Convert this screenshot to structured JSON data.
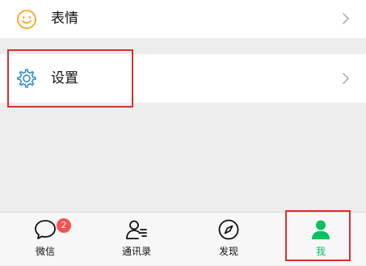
{
  "menu": {
    "emoji_label": "表情",
    "settings_label": "设置"
  },
  "tabbar": {
    "tabs": [
      {
        "label": "微信",
        "icon": "chat-bubble-icon",
        "badge": "2"
      },
      {
        "label": "通讯录",
        "icon": "contacts-icon"
      },
      {
        "label": "发现",
        "icon": "compass-icon"
      },
      {
        "label": "我",
        "icon": "person-icon",
        "active": true
      }
    ]
  },
  "colors": {
    "accent_green": "#07c160",
    "settings_icon_blue": "#3e8fd6",
    "emoji_icon_orange": "#f5a623",
    "badge_red": "#fa5151",
    "highlight_red": "#d9302c"
  }
}
